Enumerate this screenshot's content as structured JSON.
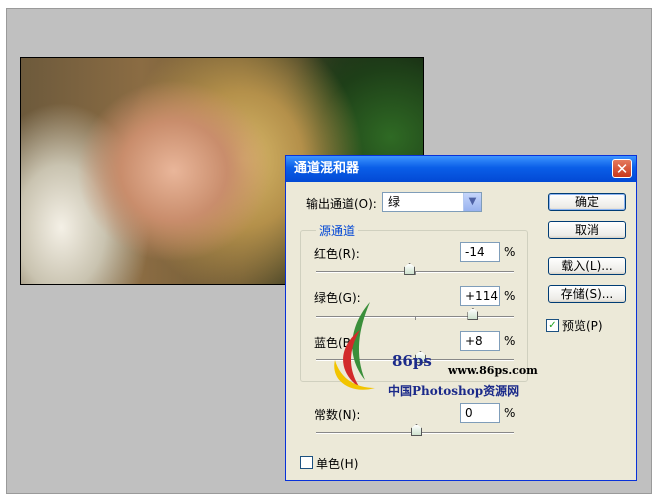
{
  "dialog": {
    "title": "通道混和器",
    "output_channel_label": "输出通道(O):",
    "output_channel_value": "绿",
    "source_group_title": "源通道",
    "red_label": "红色(R):",
    "red_value": "-14",
    "red_slider": -14,
    "green_label": "绿色(G):",
    "green_value": "+114",
    "green_slider": 114,
    "blue_label": "蓝色(B):",
    "blue_value": "+8",
    "blue_slider": 8,
    "constant_label": "常数(N):",
    "constant_value": "0",
    "constant_slider": 0,
    "percent": "%",
    "monochrome_label": "单色(H)",
    "monochrome_checked": false,
    "buttons": {
      "ok": "确定",
      "cancel": "取消",
      "load": "载入(L)...",
      "save": "存储(S)..."
    },
    "preview_label": "预览(P)",
    "preview_checked": true
  },
  "watermark": {
    "brand": "86ps",
    "url": "www.86ps.com",
    "tagline": "中国Photoshop资源网"
  },
  "icons": [
    "close-icon",
    "dropdown-arrow-icon",
    "check-icon",
    "slider-thumb-icon"
  ],
  "colors": {
    "title_gradient_top": "#3d95ff",
    "dialog_bg": "#ece9d8",
    "group_title": "#0046d5",
    "close_button": "#c9371b"
  }
}
